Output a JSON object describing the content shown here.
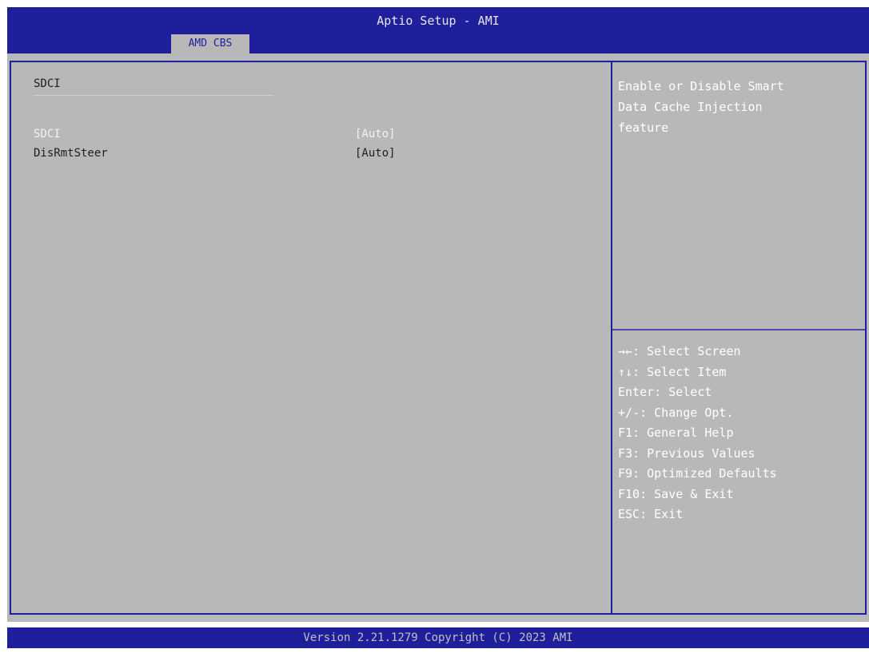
{
  "header": {
    "title": "Aptio Setup - AMI",
    "tab": "AMD CBS"
  },
  "main": {
    "section_title": "SDCI",
    "settings": [
      {
        "label": "SDCI",
        "value": "[Auto]",
        "selected": true
      },
      {
        "label": "DisRmtSteer",
        "value": "[Auto]",
        "selected": false
      }
    ]
  },
  "help": {
    "description": "Enable or Disable Smart\nData Cache Injection\nfeature",
    "keys": [
      "→←: Select Screen",
      "↑↓: Select Item",
      "Enter: Select",
      "+/-: Change Opt.",
      "F1: General Help",
      "F3: Previous Values",
      "F9: Optimized Defaults",
      "F10: Save & Exit",
      "ESC: Exit"
    ]
  },
  "footer": {
    "version": "Version 2.21.1279 Copyright (C) 2023 AMI"
  },
  "colors": {
    "header_blue": "#1f1f9c",
    "panel_gray": "#b8b8b8",
    "selected_text": "#f2f2f2"
  }
}
